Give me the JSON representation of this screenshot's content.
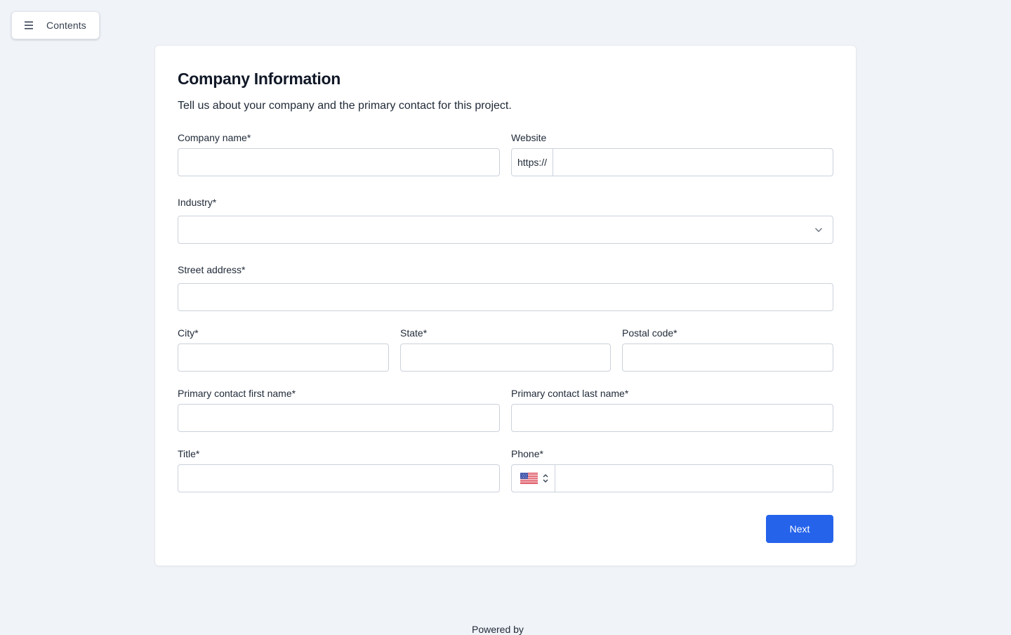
{
  "toolbar": {
    "contents_label": "Contents",
    "menu_icon": "hamburger-menu-icon"
  },
  "form": {
    "title": "Company Information",
    "subtitle": "Tell us about your company and the primary contact for this project.",
    "fields": {
      "company_name": {
        "label": "Company name*",
        "value": ""
      },
      "website": {
        "label": "Website",
        "prefix": "https://",
        "value": ""
      },
      "industry": {
        "label": "Industry*",
        "value": ""
      },
      "street_address": {
        "label": "Street address*",
        "value": ""
      },
      "city": {
        "label": "City*",
        "value": ""
      },
      "state": {
        "label": "State*",
        "value": ""
      },
      "postal_code": {
        "label": "Postal code*",
        "value": ""
      },
      "first_name": {
        "label": "Primary contact first name*",
        "value": ""
      },
      "last_name": {
        "label": "Primary contact last name*",
        "value": ""
      },
      "title_field": {
        "label": "Title*",
        "value": ""
      },
      "phone": {
        "label": "Phone*",
        "country_flag": "us-flag-icon",
        "value": ""
      }
    },
    "next_label": "Next"
  },
  "footer": {
    "powered_by": "Powered by"
  },
  "colors": {
    "accent": "#2563eb",
    "background": "#f0f3f8",
    "border": "#cbd2db"
  }
}
